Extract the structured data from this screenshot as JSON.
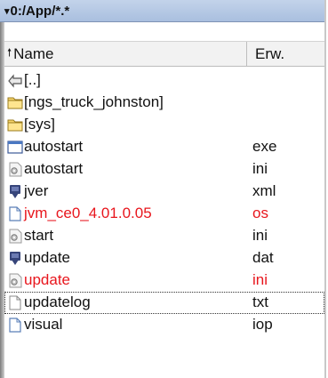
{
  "title": {
    "path": "0:/App/*.*",
    "arrow_glyph": "▾"
  },
  "header": {
    "name_label": "Name",
    "ext_label": "Erw.",
    "sort_glyph": "🠕"
  },
  "colors": {
    "highlight": "#e8161d",
    "title_bg": "#b4c7e3"
  },
  "rows": [
    {
      "name": "[..]",
      "ext": "",
      "icon": "up-folder-icon"
    },
    {
      "name": "[ngs_truck_johnston]",
      "ext": "",
      "icon": "folder-icon"
    },
    {
      "name": "[sys]",
      "ext": "",
      "icon": "folder-icon"
    },
    {
      "name": "autostart",
      "ext": "exe",
      "icon": "application-icon"
    },
    {
      "name": "autostart",
      "ext": "ini",
      "icon": "settings-file-icon"
    },
    {
      "name": "jver",
      "ext": "xml",
      "icon": "xml-file-icon"
    },
    {
      "name": "jvm_ce0_4.01.0.05",
      "ext": "os",
      "icon": "document-icon",
      "highlight": true
    },
    {
      "name": "start",
      "ext": "ini",
      "icon": "settings-file-icon"
    },
    {
      "name": "update",
      "ext": "dat",
      "icon": "xml-file-icon"
    },
    {
      "name": "update",
      "ext": "ini",
      "icon": "settings-file-icon",
      "highlight": true
    },
    {
      "name": "updatelog",
      "ext": "txt",
      "icon": "text-file-icon",
      "focused": true
    },
    {
      "name": "visual",
      "ext": "iop",
      "icon": "document-icon"
    }
  ]
}
